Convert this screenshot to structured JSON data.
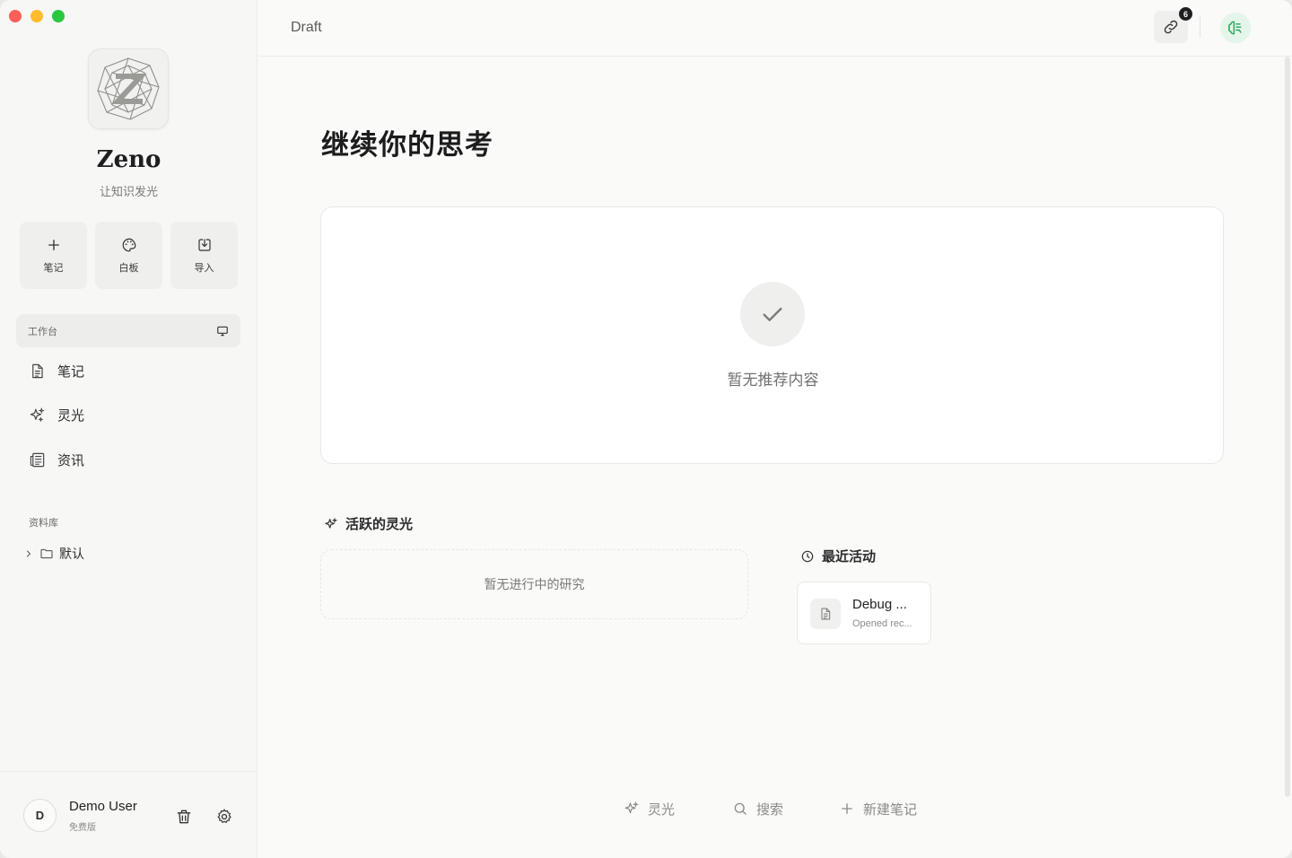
{
  "sidebar": {
    "brand": {
      "name": "Zeno",
      "tagline": "让知识发光"
    },
    "quick_actions": [
      {
        "label": "笔记",
        "icon": "plus-icon"
      },
      {
        "label": "白板",
        "icon": "palette-icon"
      },
      {
        "label": "导入",
        "icon": "import-icon"
      }
    ],
    "workspace": {
      "label": "工作台",
      "icon": "monitor-icon"
    },
    "nav": [
      {
        "label": "笔记",
        "icon": "document-icon"
      },
      {
        "label": "灵光",
        "icon": "sparkle-icon"
      },
      {
        "label": "资讯",
        "icon": "newspaper-icon"
      }
    ],
    "library": {
      "title": "资料库",
      "items": [
        {
          "label": "默认",
          "icon": "folder-icon"
        }
      ]
    },
    "user": {
      "initial": "D",
      "name": "Demo User",
      "plan": "免费版"
    }
  },
  "topbar": {
    "breadcrumb": "Draft",
    "link_count": "6"
  },
  "main": {
    "headline": "继续你的思考",
    "recommendation": {
      "empty_text": "暂无推荐内容"
    },
    "active_inspiration": {
      "title": "活跃的灵光",
      "empty_text": "暂无进行中的研究"
    },
    "recent_activity": {
      "title": "最近活动",
      "items": [
        {
          "title": "Debug ...",
          "subtitle": "Opened rec..."
        }
      ]
    },
    "bottom_actions": [
      {
        "label": "灵光",
        "icon": "sparkle-icon"
      },
      {
        "label": "搜索",
        "icon": "search-icon"
      },
      {
        "label": "新建笔记",
        "icon": "plus-icon"
      }
    ]
  },
  "colors": {
    "accent_green": "#22a55a",
    "badge_dark": "#1f1f1f",
    "window_bg": "#fafaf9"
  }
}
